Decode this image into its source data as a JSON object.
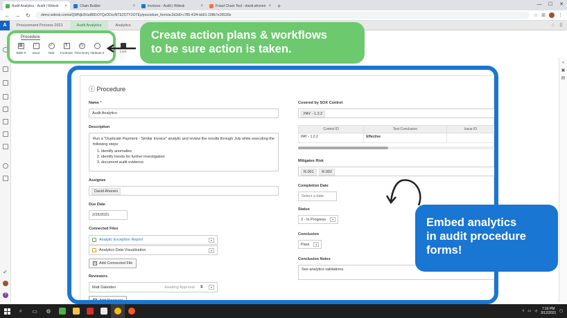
{
  "browser": {
    "tabs": [
      {
        "label": "Audit Analytics - Audit | Wdesk",
        "color": "#4caf50",
        "active": true
      },
      {
        "label": "Chain Builder",
        "color": "#1976d2",
        "active": false
      },
      {
        "label": "Invoices - Audit | Wdesk",
        "color": "#1976d2",
        "active": false
      },
      {
        "label": "Fraud Chain Test - david.ahonen",
        "color": "#ff7043",
        "active": false
      }
    ],
    "new_tab": "+",
    "url": "demo.wdesk.com/a/QWNjb3VudB81OTQzODczNTE2OTY2OTEy/procedure_form/ac2d2d0-c785-41f4-bb01-108b7e26530e",
    "win_min": "—",
    "win_max": "☐",
    "win_close": "✕"
  },
  "app": {
    "logo": "A",
    "tabs": [
      {
        "label": "Procurement Process 2021",
        "active": false
      },
      {
        "label": "Audit Analytics",
        "active": true
      },
      {
        "label": "Analytics",
        "active": false
      }
    ]
  },
  "toolbar": {
    "title": "Procedure",
    "items": [
      {
        "label": "Table ▾",
        "glyph": "▦"
      },
      {
        "label": "Issue",
        "glyph": "!"
      },
      {
        "label": "Task",
        "glyph": "✓"
      },
      {
        "label": "Footnote",
        "glyph": "¶"
      },
      {
        "label": "Time Entry",
        "glyph": "◷"
      },
      {
        "label": "Attribute ▾",
        "glyph": "◌"
      }
    ],
    "lock": "Lock"
  },
  "callouts": {
    "green_line1": "Create action plans & workflows",
    "green_line2": "to be sure action is taken.",
    "blue_line1": "Embed analytics",
    "blue_line2": "in audit procedure",
    "blue_line3": "forms!"
  },
  "form": {
    "title": "Procedure",
    "title_icon": "ⓘ",
    "name_label": "Name",
    "name_req": "*",
    "name_value": "Audit Analytics",
    "description_label": "Description",
    "description_text": "Run a \"Duplicate Payment - Similar Invoice\" analytic and review the results through July while executing the following steps:",
    "description_steps": [
      "identify anomalies",
      "identify trends for further investigation",
      "document audit evidence"
    ],
    "assignee_label": "Assignee",
    "assignee_value": "David Ahonen",
    "due_label": "Due Date",
    "due_value": "2/26/2021",
    "files_label": "Connected Files",
    "files": [
      "Analytic Exception Report",
      "Analytics Data Visualization"
    ],
    "add_file": "Add Connected File",
    "reviewers_label": "Reviewers",
    "reviewer_name": "Matt Daleiden",
    "reviewer_status": "Awaiting Approval",
    "add_reviewer": "Add Reviewer",
    "sox_label": "Covered by SOX Control",
    "sox_value": "PAY - 1.2.2",
    "table_headers": [
      "Control ID",
      "Test Conclusion",
      "Issue ID"
    ],
    "table_row": [
      "PAY - 1.2.2",
      "Effective",
      ""
    ],
    "risk_label": "Mitigates Risk",
    "risks": [
      "R.001",
      "R.002"
    ],
    "completion_label": "Completion Date",
    "completion_placeholder": "Select a date",
    "status_label": "Status",
    "status_value": "2 - In Progress",
    "conclusion_label": "Conclusion",
    "conclusion_value": "Pass",
    "notes_label": "Conclusion Notes",
    "notes_value": "See analytics validations."
  },
  "taskbar": {
    "time": "7:16 PM",
    "date": "3/12/2021"
  }
}
